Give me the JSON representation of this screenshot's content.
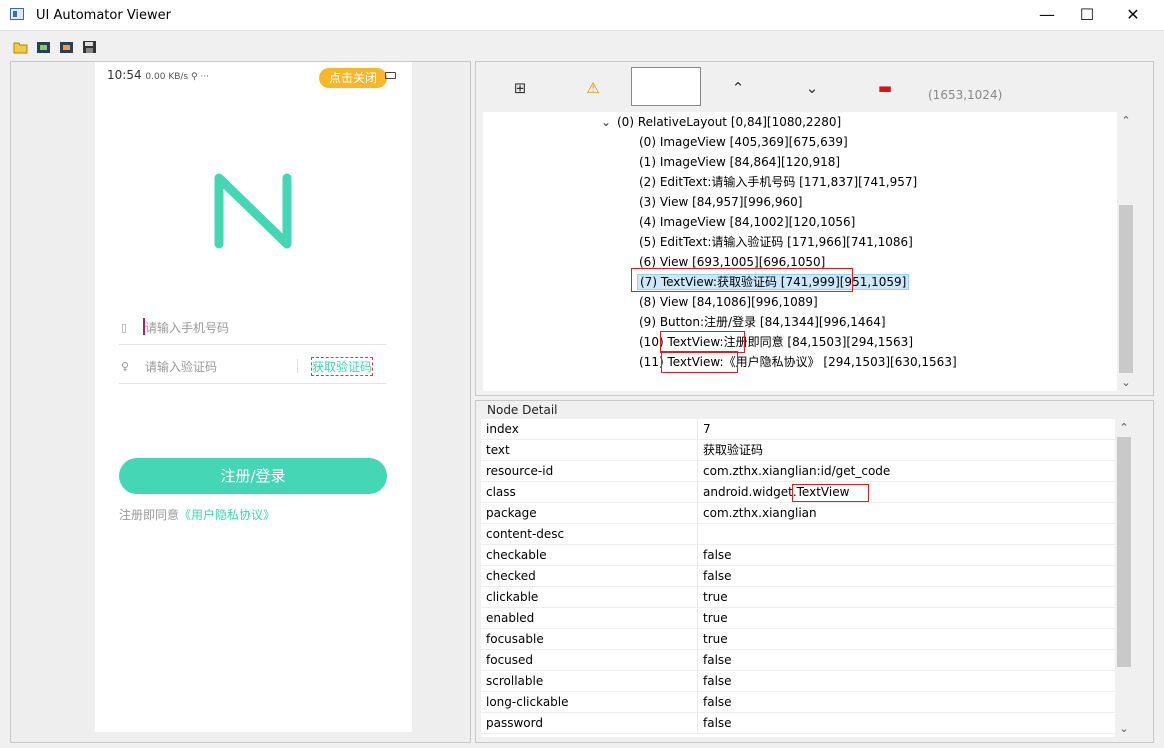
{
  "window": {
    "title": "UI Automator Viewer",
    "minimize": "—",
    "maximize": "☐",
    "close": "✕"
  },
  "phone": {
    "status_time": "10:54",
    "status_extra": "0.00 KB/s  ⚲ ···",
    "pill_text": "点击关闭",
    "phone_placeholder": "请输入手机号码",
    "code_placeholder": "请输入验证码",
    "get_code": "获取验证码",
    "register": "注册/登录",
    "agree_prefix": "注册即同意",
    "agree_link": "《用户隐私协议》"
  },
  "hierarchy": {
    "coords": "(1653,1024)",
    "root": "(0) RelativeLayout [0,84][1080,2280]",
    "children": [
      "(0) ImageView [405,369][675,639]",
      "(1) ImageView [84,864][120,918]",
      "(2) EditText:请输入手机号码 [171,837][741,957]",
      "(3) View [84,957][996,960]",
      "(4) ImageView [84,1002][120,1056]",
      "(5) EditText:请输入验证码 [171,966][741,1086]",
      "(6) View [693,1005][696,1050]",
      "(7) TextView:获取验证码 [741,999][951,1059]",
      "(8) View [84,1086][996,1089]",
      "(9) Button:注册/登录 [84,1344][996,1464]",
      "(10) TextView:注册即同意 [84,1503][294,1563]",
      "(11) TextView:《用户隐私协议》 [294,1503][630,1563]"
    ]
  },
  "node_detail": {
    "title": "Node Detail",
    "rows": [
      {
        "k": "index",
        "v": "7"
      },
      {
        "k": "text",
        "v": "获取验证码"
      },
      {
        "k": "resource-id",
        "v": "com.zthx.xianglian:id/get_code"
      },
      {
        "k": "class",
        "v": "android.widget.TextView"
      },
      {
        "k": "package",
        "v": "com.zthx.xianglian"
      },
      {
        "k": "content-desc",
        "v": ""
      },
      {
        "k": "checkable",
        "v": "false"
      },
      {
        "k": "checked",
        "v": "false"
      },
      {
        "k": "clickable",
        "v": "true"
      },
      {
        "k": "enabled",
        "v": "true"
      },
      {
        "k": "focusable",
        "v": "true"
      },
      {
        "k": "focused",
        "v": "false"
      },
      {
        "k": "scrollable",
        "v": "false"
      },
      {
        "k": "long-clickable",
        "v": "false"
      },
      {
        "k": "password",
        "v": "false"
      }
    ]
  },
  "colors": {
    "accent": "#45d6b5",
    "selection": "#cce8ff",
    "highlight": "#e02020"
  },
  "icons": [
    "open-folder-icon",
    "screenshot-icon",
    "screenshot-compressed-icon",
    "save-icon",
    "expand-all-icon",
    "warning-icon",
    "up-arrow-icon",
    "down-arrow-icon",
    "toggle-naf-icon"
  ]
}
